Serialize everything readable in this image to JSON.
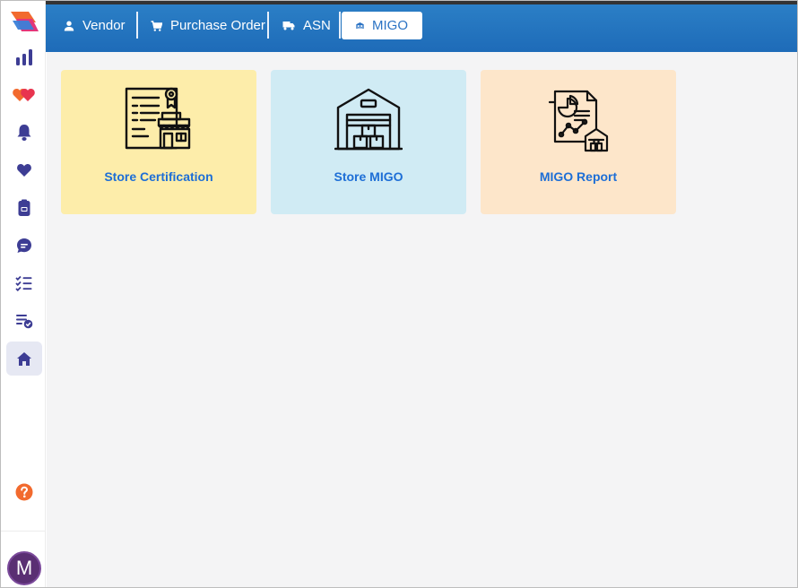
{
  "colors": {
    "topbar": "#2377c2",
    "accent_text": "#1d6ed6",
    "card_store_certification": "#fdedaa",
    "card_store_migo": "#d0ebf4",
    "card_migo_report": "#fde6ca",
    "sidebar_icon": "#3d3d94",
    "help_icon": "#f26a2e",
    "avatar": "#5a2f73"
  },
  "sidebar": {
    "items": [
      {
        "icon": "bar-chart-icon"
      },
      {
        "icon": "hearts-icon"
      },
      {
        "icon": "bell-icon"
      },
      {
        "icon": "heart-icon"
      },
      {
        "icon": "document-icon"
      },
      {
        "icon": "chat-bubble-icon"
      },
      {
        "icon": "checklist-icon"
      },
      {
        "icon": "list-check-icon"
      },
      {
        "icon": "home-icon",
        "active": true
      }
    ],
    "help_icon": "help-icon",
    "avatar_initial": "M"
  },
  "topbar": {
    "tabs": [
      {
        "label": "Vendor",
        "icon": "person-icon"
      },
      {
        "label": "Purchase Order",
        "icon": "cart-icon"
      },
      {
        "label": "ASN",
        "icon": "truck-icon"
      },
      {
        "label": "MIGO",
        "icon": "warehouse-icon",
        "active": true
      }
    ]
  },
  "cards": [
    {
      "label": "Store Certification",
      "icon": "store-certification-icon"
    },
    {
      "label": "Store MIGO",
      "icon": "warehouse-icon"
    },
    {
      "label": "MIGO Report",
      "icon": "report-chart-icon"
    }
  ]
}
